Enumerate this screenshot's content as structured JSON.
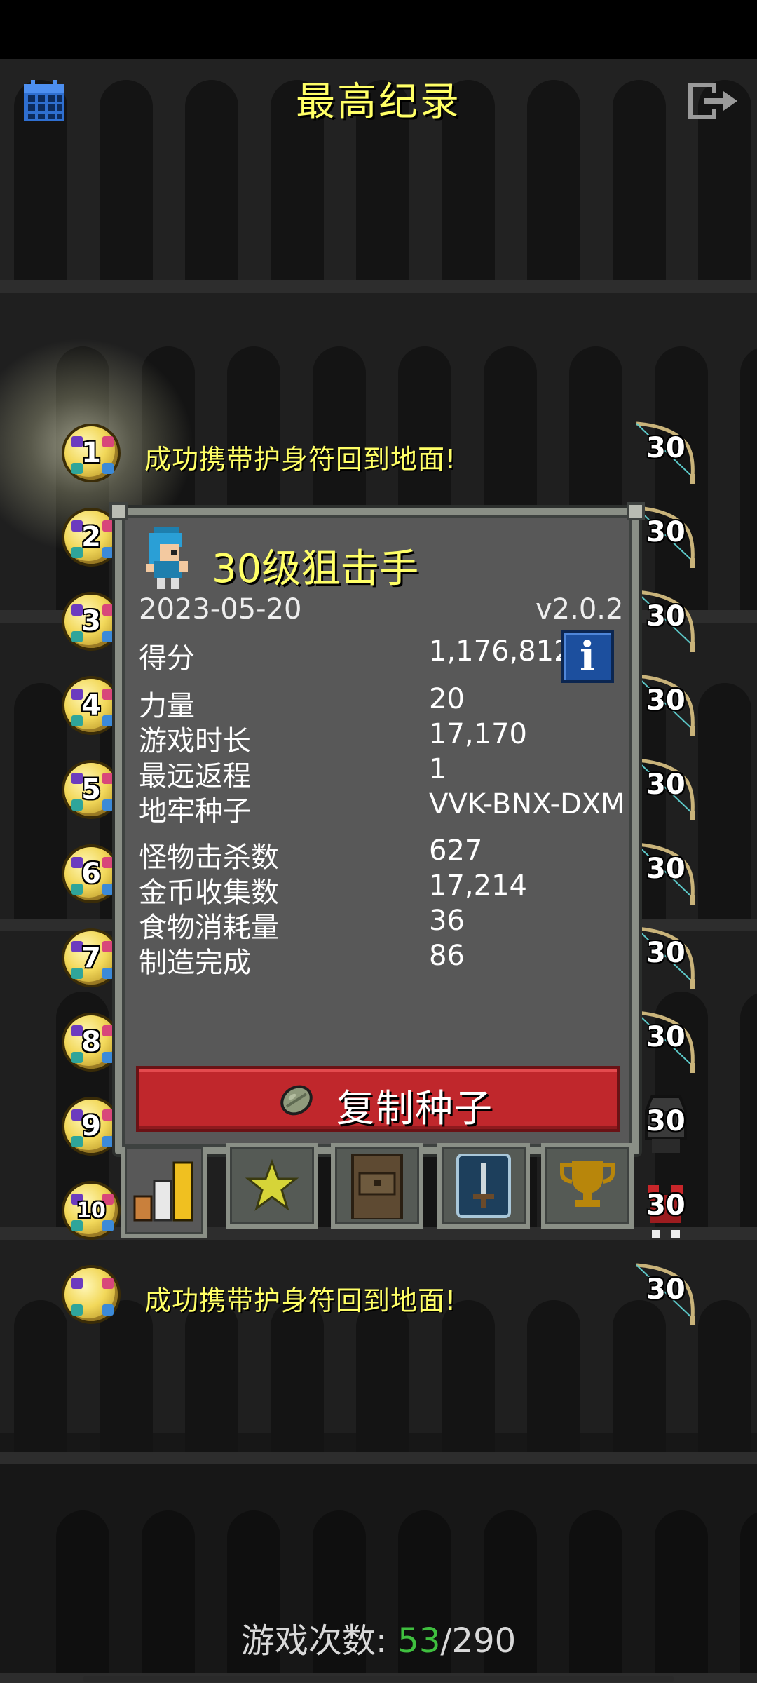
{
  "header": {
    "title": "最高纪录",
    "calendar_icon": "calendar-icon",
    "exit_icon": "exit-icon"
  },
  "records": [
    {
      "rank": "1",
      "description": "成功携带护身符回到地面!",
      "level": "30",
      "class_icon": "bow-icon"
    },
    {
      "rank": "2",
      "level": "30",
      "class_icon": "bow-icon"
    },
    {
      "rank": "3",
      "level": "30",
      "class_icon": "bow-icon"
    },
    {
      "rank": "4",
      "level": "30",
      "class_icon": "bow-icon"
    },
    {
      "rank": "5",
      "level": "30",
      "class_icon": "bow-icon"
    },
    {
      "rank": "6",
      "level": "30",
      "class_icon": "bow-icon"
    },
    {
      "rank": "7",
      "level": "30",
      "class_icon": "bow-icon"
    },
    {
      "rank": "8",
      "level": "30",
      "class_icon": "bow-icon"
    },
    {
      "rank": "9",
      "level": "30",
      "class_icon": "hooded-icon"
    },
    {
      "rank": "10",
      "level": "30",
      "class_icon": "warrior-icon"
    },
    {
      "rank": "",
      "description": "成功携带护身符回到地面!",
      "level": "30",
      "class_icon": "bow-icon"
    }
  ],
  "detail": {
    "title": "30级狙击手",
    "date": "2023-05-20",
    "version": "v2.0.2",
    "score_label": "得分",
    "score_value": "1,176,812",
    "stats": [
      {
        "label": "力量",
        "value": "20"
      },
      {
        "label": "游戏时长",
        "value": "17,170"
      },
      {
        "label": "最远返程",
        "value": "1"
      },
      {
        "label": "地牢种子",
        "value": "VVK-BNX-DXM"
      },
      {
        "label": "怪物击杀数",
        "value": "627"
      },
      {
        "label": "金币收集数",
        "value": "17,214"
      },
      {
        "label": "食物消耗量",
        "value": "36"
      },
      {
        "label": "制造完成",
        "value": "86"
      }
    ],
    "copy_seed_label": "复制种子",
    "tabs": [
      "stats-tab",
      "badges-tab",
      "items-tab",
      "talents-tab",
      "trophy-tab"
    ]
  },
  "footer": {
    "games_label": "游戏次数: ",
    "games_won": "53",
    "games_total": "/290"
  },
  "colors": {
    "title_yellow": "#ffff66",
    "copy_button_red": "#c0272c",
    "info_button_blue": "#1c4f9e",
    "games_won_green": "#3fbf3f"
  }
}
